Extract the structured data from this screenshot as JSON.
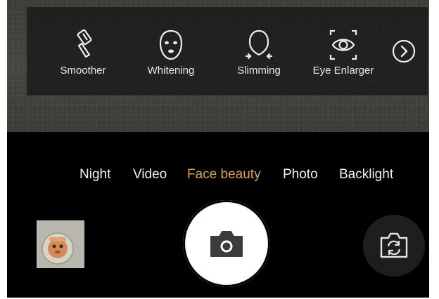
{
  "beauty_tools": [
    {
      "label": "Smoother",
      "icon": "smoother-brush-icon"
    },
    {
      "label": "Whitening",
      "icon": "face-mask-icon"
    },
    {
      "label": "Slimming",
      "icon": "face-slim-icon"
    },
    {
      "label": "Eye Enlarger",
      "icon": "eye-enlarge-icon"
    }
  ],
  "more_icon": "chevron-right-circle-icon",
  "modes": [
    {
      "label": "Night",
      "active": false
    },
    {
      "label": "Video",
      "active": false
    },
    {
      "label": "Face beauty",
      "active": true
    },
    {
      "label": "Photo",
      "active": false
    },
    {
      "label": "Backlight",
      "active": false
    }
  ],
  "colors": {
    "active_mode": "#d9a451",
    "mode_text": "#f2f2f2",
    "background": "#000000"
  },
  "controls": {
    "gallery_icon": "gallery-thumbnail",
    "shutter_icon": "camera-icon",
    "switch_icon": "camera-switch-icon"
  }
}
